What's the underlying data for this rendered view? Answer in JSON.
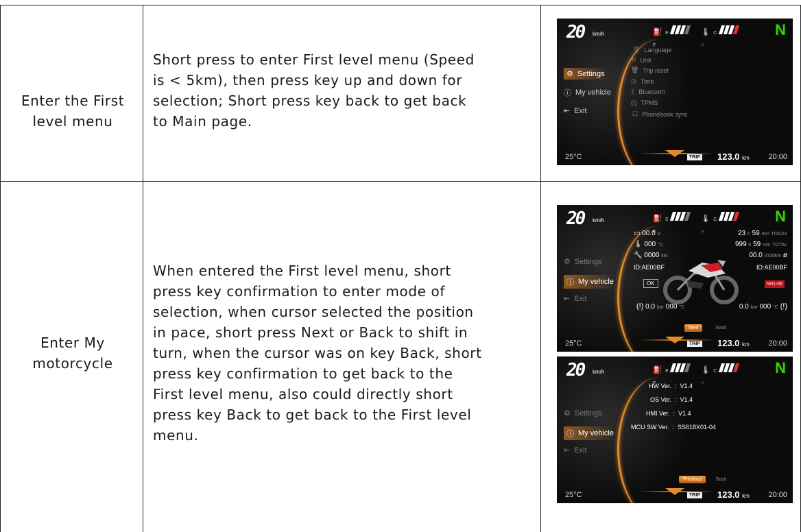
{
  "rows": [
    {
      "title": "Enter the First level menu",
      "title_lines": [
        "Enter the First",
        "level menu"
      ],
      "description_lines": [
        "Short press to enter First level menu (Speed",
        "is < 5km), then press key up and down for",
        "selection; Short press key back to get back",
        "to Main page."
      ]
    },
    {
      "title": "Enter My motorcycle",
      "title_lines": [
        "Enter My",
        "motorcycle"
      ],
      "description_lines": [
        "When entered the First level menu, short",
        "press key confirmation to enter mode of",
        "selection, when cursor selected the position",
        "in pace, short press Next or Back to shift in",
        "turn, when the cursor was on key Back, short",
        "press key confirmation to get back to the",
        "First level menu, also could directly short",
        "press key Back to get back to the First level",
        "menu."
      ]
    }
  ],
  "screen_common": {
    "speed": "20",
    "speed_unit": "km/h",
    "gear": "N",
    "fuel_e": "E",
    "fuel_f": "F",
    "temp_c": "C",
    "temp_h": "H",
    "ambient_temp": "25°C",
    "trip_badge": "TRIP",
    "odometer": "123.0",
    "odometer_unit": "km",
    "clock": "20:00"
  },
  "screen1": {
    "menu": [
      "Settings",
      "My vehicle",
      "Exit"
    ],
    "submenu": [
      "Language",
      "Unit",
      "Trip reset",
      "Time",
      "Bluetooth",
      "TPMS",
      "Phonebook sync"
    ]
  },
  "screen2": {
    "menu": [
      "Settings",
      "My vehicle",
      "Exit"
    ],
    "left_readouts": [
      {
        "value": "00.0",
        "unit": "V"
      },
      {
        "value": "000",
        "unit": "°C"
      },
      {
        "value": "0000",
        "unit": "km"
      }
    ],
    "right_readouts": [
      {
        "value": "23",
        "unit1": "h",
        "value2": "59",
        "unit2": "min",
        "tag": "TODAY"
      },
      {
        "value": "999",
        "unit1": "h",
        "value2": "59",
        "unit2": "min",
        "tag": "TOTAL"
      },
      {
        "value": "00.0",
        "unit1": "l/100km",
        "value2": "",
        "unit2": "",
        "tag": "ø"
      }
    ],
    "id_left": "ID:AE00BF",
    "id_right": "ID:AE00BF",
    "ok_label": "OK",
    "red_label": "N01-06",
    "tp_left": {
      "bar": "0.0",
      "bar_unit": "bar",
      "temp": "000",
      "temp_unit": "°C"
    },
    "tp_right": {
      "bar": "0.0",
      "bar_unit": "bar",
      "temp": "000",
      "temp_unit": "°C"
    },
    "next_label": "Next",
    "back_label": "Back"
  },
  "screen3": {
    "menu": [
      "Settings",
      "My vehicle",
      "Exit"
    ],
    "versions": [
      "HW Ver.  :  V1.4",
      "OS Ver.  :  V1.4",
      "HMI Ver.  :  V1.4",
      "MCU SW Ver.  :  SS618X01-04"
    ],
    "previous_label": "Previous",
    "back_label": "Back"
  }
}
